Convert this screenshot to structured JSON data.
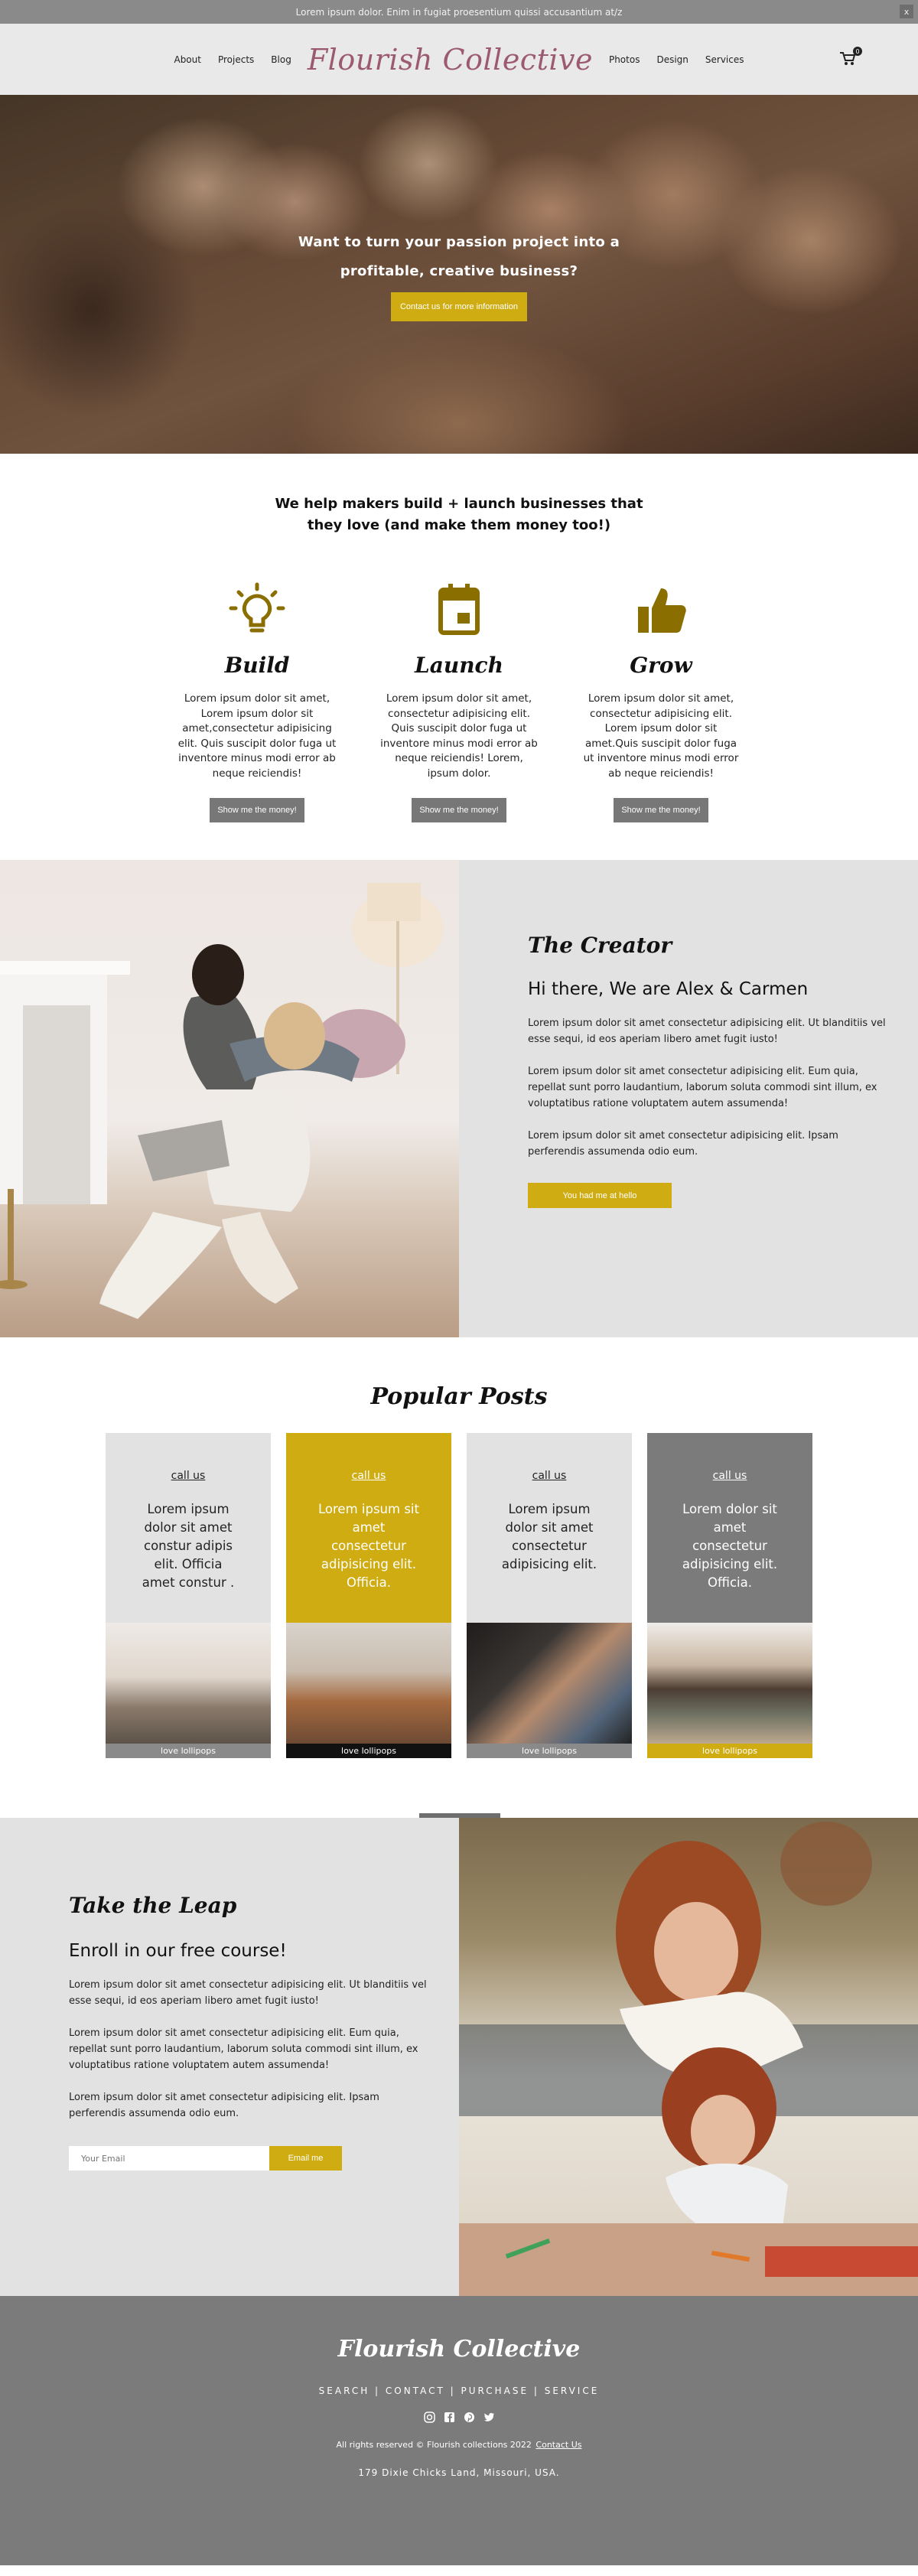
{
  "announcement": {
    "text": "Lorem ipsum dolor. Enim in fugiat proesentium quissi accusantium at/z",
    "close_label": "x"
  },
  "nav": {
    "left": [
      "About",
      "Projects",
      "Blog"
    ],
    "logo": "Flourish Collective",
    "right": [
      "Photos",
      "Design",
      "Services"
    ],
    "cart_count": "0"
  },
  "hero": {
    "line1": "Want to turn your passion project into a",
    "line2": "profitable, creative business?",
    "button": "Contact us for more information"
  },
  "help": {
    "line1": "We help makers build + launch businesses that",
    "line2": "they love (and make them money too!)",
    "columns": [
      {
        "icon": "lightbulb-icon",
        "title": "Build",
        "text": "Lorem ipsum dolor sit amet, Lorem ipsum dolor sit amet,consectetur adipisicing elit. Quis suscipit dolor fuga ut inventore minus modi error ab neque reiciendis!",
        "button": "Show me the money!"
      },
      {
        "icon": "calendar-icon",
        "title": "Launch",
        "text": "Lorem ipsum dolor sit amet, consectetur adipisicing elit. Quis suscipit dolor fuga ut inventore minus modi error ab neque reiciendis! Lorem, ipsum dolor.",
        "button": "Show me the money!"
      },
      {
        "icon": "thumbs-up-icon",
        "title": "Grow",
        "text": "Lorem ipsum dolor sit amet, consectetur adipisicing elit. Lorem ipsum dolor sit amet.Quis suscipit dolor fuga ut inventore minus modi error ab neque reiciendis!",
        "button": "Show me the money!"
      }
    ]
  },
  "creator": {
    "script": "The Creator",
    "heading": "Hi there, We are Alex & Carmen",
    "paragraphs": [
      "Lorem ipsum dolor sit amet consectetur adipisicing elit. Ut blanditiis vel esse sequi, id eos aperiam libero amet fugit iusto!",
      "Lorem ipsum dolor sit amet consectetur adipisicing elit. Eum quia, repellat sunt porro laudantium, laborum soluta commodi sint illum, ex voluptatibus ratione voluptatem autem assumenda!",
      "Lorem ipsum dolor sit amet consectetur adipisicing elit. Ipsam perferendis assumenda odio eum."
    ],
    "button": "You had me at hello"
  },
  "posts": {
    "title": "Popular Posts",
    "cards": [
      {
        "link": "call us",
        "text": "Lorem ipsum dolor sit amet constur adipis elit. Officia amet constur .",
        "footer": "love lollipops",
        "bg": "#e2e2e2",
        "text_color": "#222",
        "foot_bg": "#8a8a8a"
      },
      {
        "link": "call us",
        "text": "Lorem ipsum sit amet consectetur adipisicing elit. Officia.",
        "footer": "love lollipops",
        "bg": "#cfac12",
        "text_color": "#fff",
        "foot_bg": "#111111"
      },
      {
        "link": "call us",
        "text": "Lorem ipsum dolor sit amet consectetur adipisicing elit.",
        "footer": "love lollipops",
        "bg": "#e2e2e2",
        "text_color": "#222",
        "foot_bg": "#8a8a8a"
      },
      {
        "link": "call us",
        "text": "Lorem dolor sit amet consectetur adipisicing elit. Officia.",
        "footer": "love lollipops",
        "bg": "#7b7b7b",
        "text_color": "#fff",
        "foot_bg": "#cfac12"
      }
    ]
  },
  "leap": {
    "script": "Take the Leap",
    "heading": "Enroll in our free course!",
    "paragraphs": [
      "Lorem ipsum dolor sit amet consectetur adipisicing elit. Ut blanditiis vel esse sequi, id eos aperiam libero amet fugit iusto!",
      "Lorem ipsum dolor sit amet consectetur adipisicing elit. Eum quia, repellat sunt porro laudantium, laborum soluta commodi sint illum, ex voluptatibus ratione voluptatem autem assumenda!",
      "Lorem ipsum dolor sit amet consectetur adipisicing elit. Ipsam perferendis assumenda odio eum."
    ],
    "email_placeholder": "Your Email",
    "button": "Email me"
  },
  "footer": {
    "logo": "Flourish Collective",
    "links": "SEARCH | CONTACT | PURCHASE | SERVICE",
    "social": [
      "instagram-icon",
      "facebook-icon",
      "pinterest-icon",
      "twitter-icon"
    ],
    "copyright": "All rights reserved © Flourish collections 2022",
    "contact_link": "Contact Us",
    "address": "179 Dixie Chicks Land, Missouri, USA."
  },
  "colors": {
    "gold": "#cfac12",
    "grey": "#777777",
    "logo_pink": "#9c5a70",
    "footer_bg": "#7b7b7b"
  }
}
